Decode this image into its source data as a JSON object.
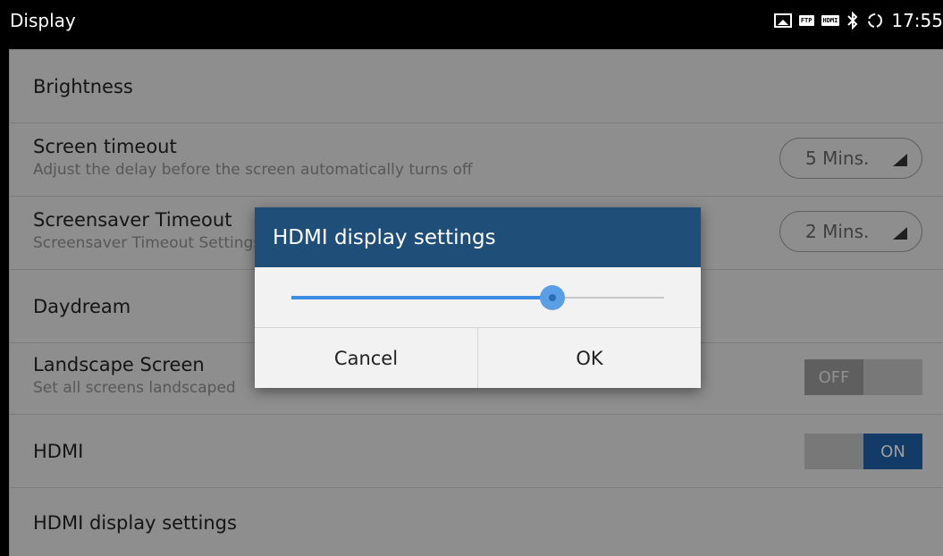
{
  "statusbar": {
    "title": "Display",
    "icons": [
      "image-icon",
      "ftp-icon",
      "hdmi-icon",
      "bluetooth-icon",
      "sync-icon"
    ],
    "ftp_tag": "FTP",
    "hdmi_tag": "HDMI",
    "time": "17:55"
  },
  "settings": {
    "brightness": {
      "label": "Brightness"
    },
    "screen_timeout": {
      "label": "Screen timeout",
      "subtitle": "Adjust the delay before the screen automatically turns off",
      "value": "5 Mins."
    },
    "screensaver_timeout": {
      "label": "Screensaver Timeout",
      "subtitle": "Screensaver Timeout Settings",
      "value": "2 Mins."
    },
    "daydream": {
      "label": "Daydream"
    },
    "landscape": {
      "label": "Landscape Screen",
      "subtitle": "Set all screens landscaped",
      "toggle": "OFF"
    },
    "hdmi": {
      "label": "HDMI",
      "toggle": "ON"
    },
    "hdmi_display": {
      "label": "HDMI display settings"
    }
  },
  "dialog": {
    "title": "HDMI display settings",
    "slider_value": 0.7,
    "cancel_label": "Cancel",
    "ok_label": "OK"
  },
  "colors": {
    "dialog_header": "#1f4e79",
    "slider_accent": "#3d8de0",
    "toggle_on": "#1f5fa8"
  }
}
